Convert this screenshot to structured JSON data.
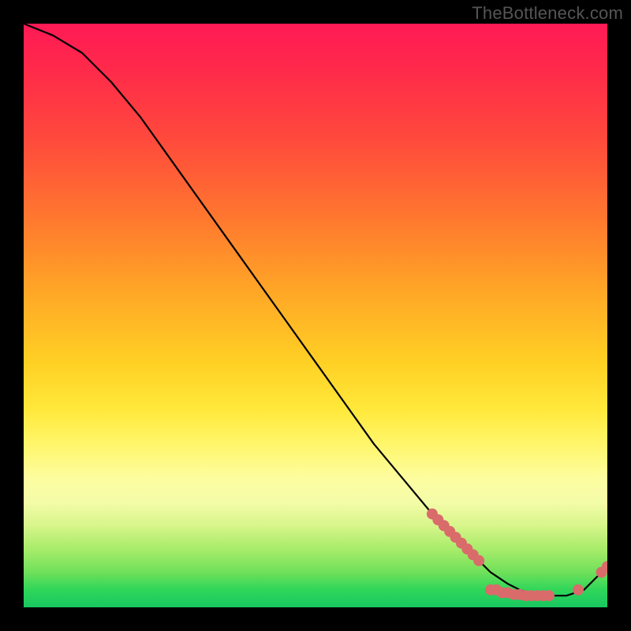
{
  "watermark": "TheBottleneck.com",
  "chart_data": {
    "type": "line",
    "title": "",
    "xlabel": "",
    "ylabel": "",
    "xlim": [
      0,
      100
    ],
    "ylim": [
      0,
      100
    ],
    "series": [
      {
        "name": "curve",
        "x": [
          0,
          5,
          10,
          15,
          20,
          25,
          30,
          35,
          40,
          45,
          50,
          55,
          60,
          65,
          70,
          72,
          75,
          78,
          80,
          83,
          85,
          88,
          90,
          93,
          96,
          98,
          100
        ],
        "y": [
          100,
          98,
          95,
          90,
          84,
          77,
          70,
          63,
          56,
          49,
          42,
          35,
          28,
          22,
          16,
          14,
          11,
          8,
          6,
          4,
          3,
          2,
          2,
          2,
          3,
          5,
          7
        ]
      }
    ],
    "markers": [
      {
        "x": 70.0,
        "y": 16.0
      },
      {
        "x": 71.0,
        "y": 15.0
      },
      {
        "x": 72.0,
        "y": 14.0
      },
      {
        "x": 73.0,
        "y": 13.0
      },
      {
        "x": 74.0,
        "y": 12.0
      },
      {
        "x": 75.0,
        "y": 11.0
      },
      {
        "x": 76.0,
        "y": 10.0
      },
      {
        "x": 77.0,
        "y": 9.0
      },
      {
        "x": 78.0,
        "y": 8.0
      },
      {
        "x": 80.0,
        "y": 3.0
      },
      {
        "x": 81.0,
        "y": 3.0
      },
      {
        "x": 82.0,
        "y": 2.5
      },
      {
        "x": 83.0,
        "y": 2.5
      },
      {
        "x": 84.0,
        "y": 2.2
      },
      {
        "x": 85.0,
        "y": 2.2
      },
      {
        "x": 86.0,
        "y": 2.0
      },
      {
        "x": 87.0,
        "y": 2.0
      },
      {
        "x": 88.0,
        "y": 2.0
      },
      {
        "x": 89.0,
        "y": 2.0
      },
      {
        "x": 90.0,
        "y": 2.0
      },
      {
        "x": 95.0,
        "y": 3.0
      },
      {
        "x": 99.0,
        "y": 6.0
      },
      {
        "x": 100.0,
        "y": 7.0
      }
    ],
    "colors": {
      "curve": "#000000",
      "markers": "#d96b6b",
      "gradient_top": "#ff1a55",
      "gradient_bottom": "#18c760"
    }
  }
}
